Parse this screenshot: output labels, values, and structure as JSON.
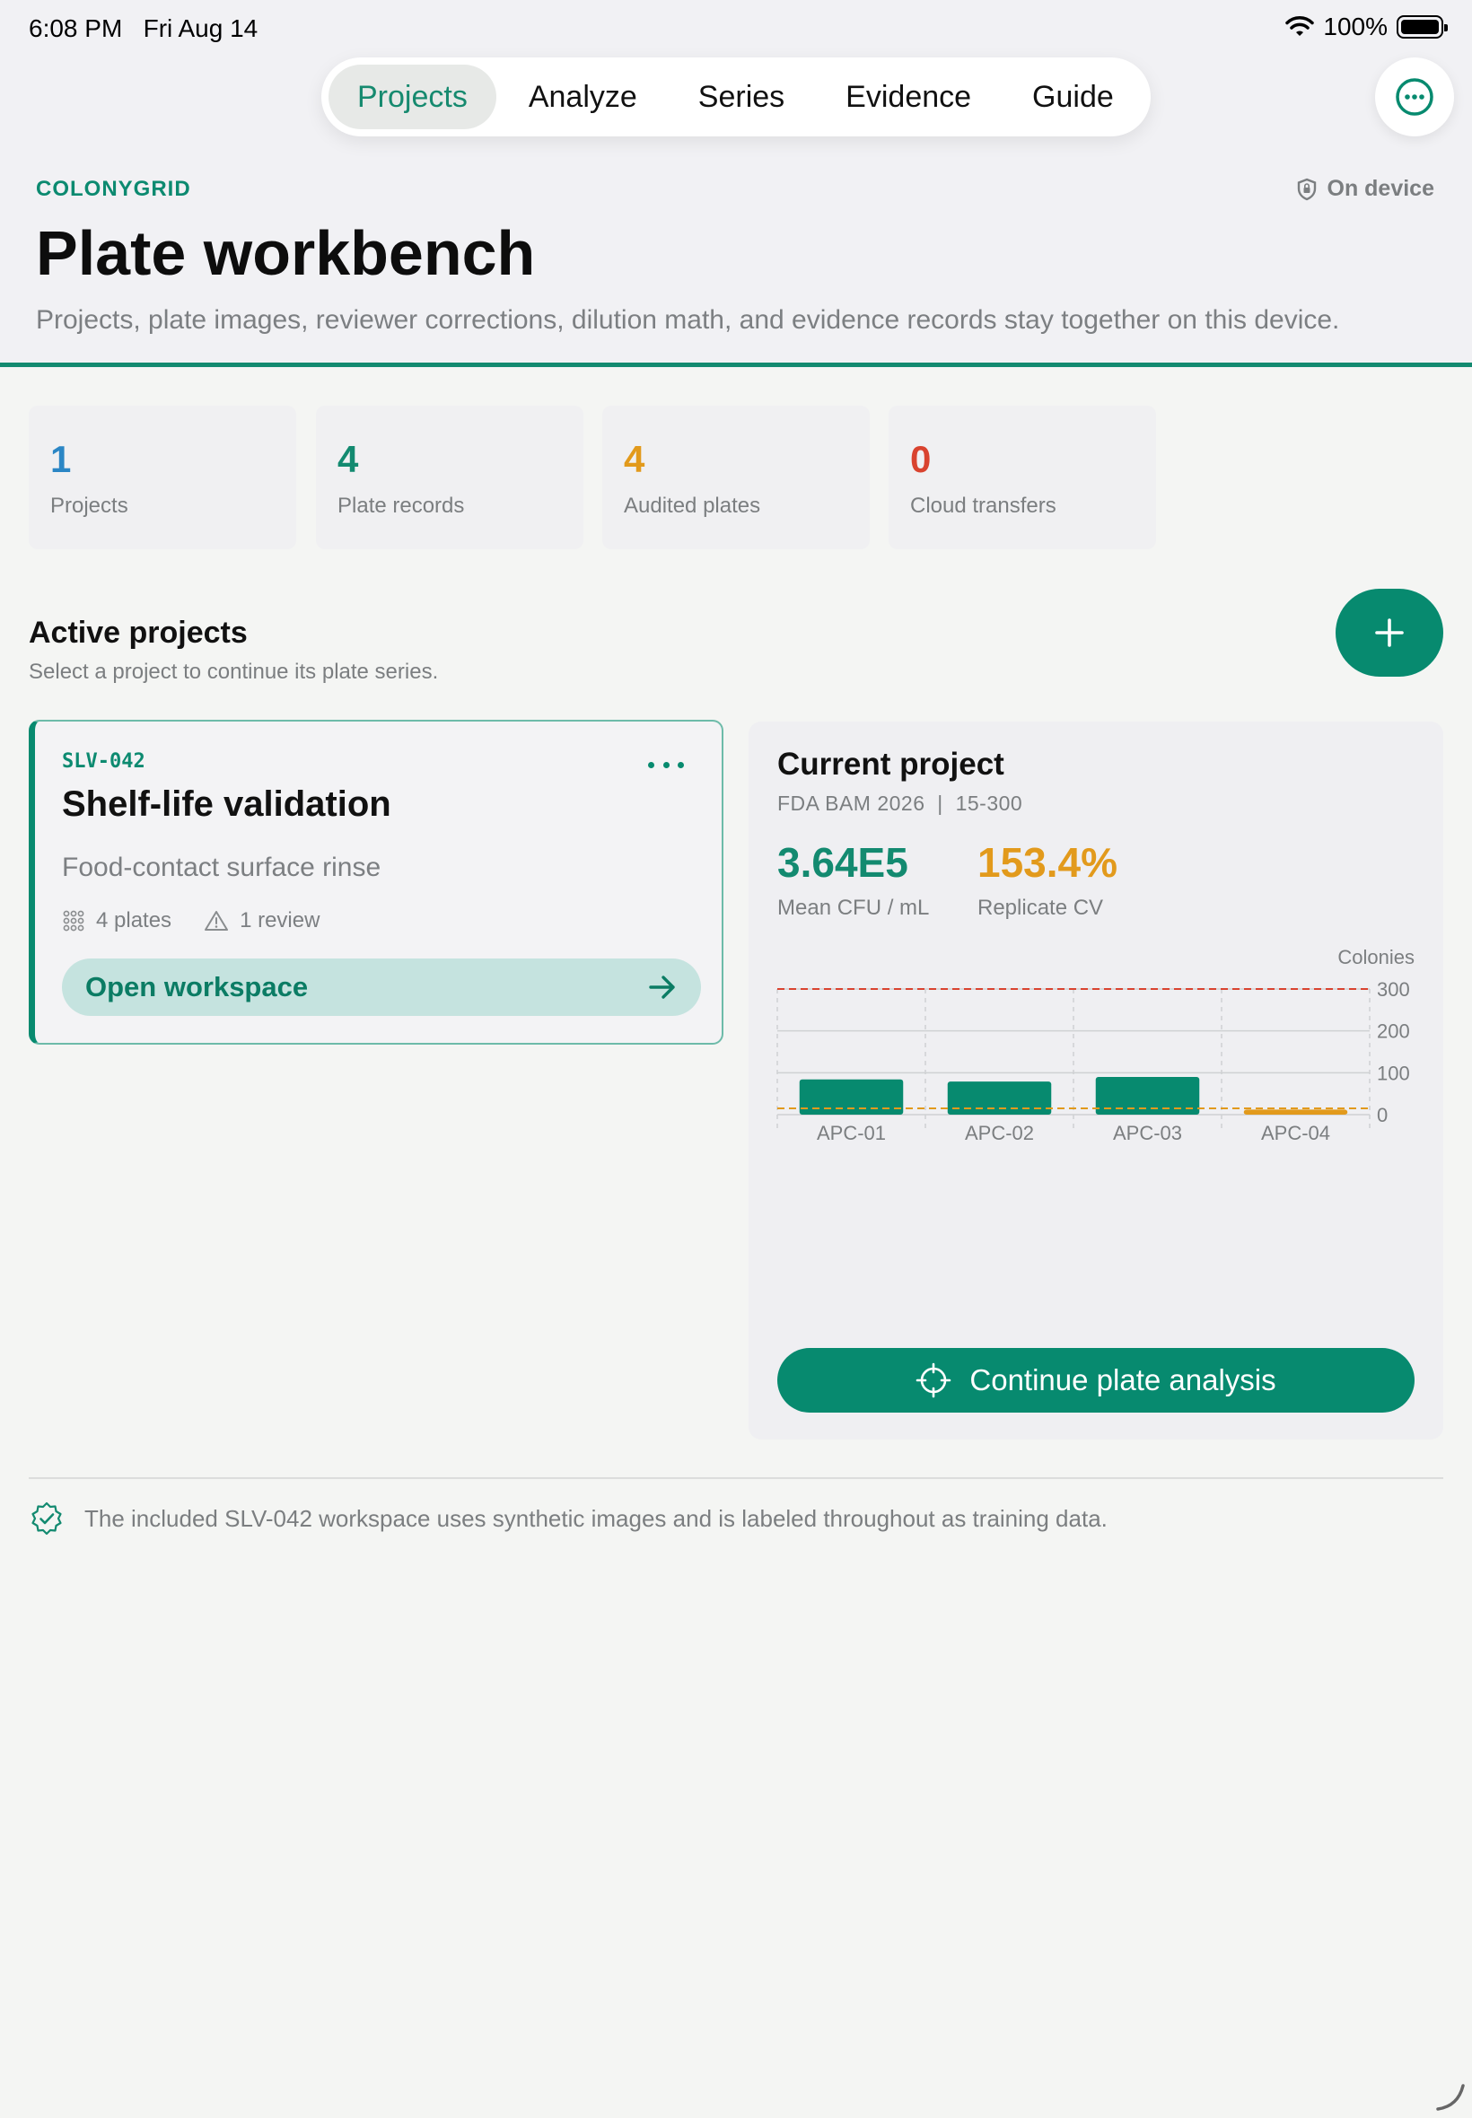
{
  "status_bar": {
    "time": "6:08 PM",
    "date": "Fri Aug 14",
    "battery": "100%",
    "icons": [
      "wifi-icon",
      "battery-icon"
    ]
  },
  "tabs": [
    {
      "label": "Projects",
      "active": true
    },
    {
      "label": "Analyze",
      "active": false
    },
    {
      "label": "Series",
      "active": false
    },
    {
      "label": "Evidence",
      "active": false
    },
    {
      "label": "Guide",
      "active": false
    }
  ],
  "header": {
    "brand": "COLONYGRID",
    "privacy": "On device",
    "title": "Plate workbench",
    "subtitle": "Projects, plate images, reviewer corrections, dilution math, and evidence records stay together on this device."
  },
  "stats": [
    {
      "value": "1",
      "label": "Projects",
      "color": "#2b86c5"
    },
    {
      "value": "4",
      "label": "Plate records",
      "color": "#138a70"
    },
    {
      "value": "4",
      "label": "Audited plates",
      "color": "#e29a1c"
    },
    {
      "value": "0",
      "label": "Cloud transfers",
      "color": "#d9432f"
    }
  ],
  "active_projects": {
    "title": "Active projects",
    "subtitle": "Select a project to continue its plate series."
  },
  "project_card": {
    "code": "SLV-042",
    "title": "Shelf-life validation",
    "description": "Food-contact surface rinse",
    "plates": "4 plates",
    "reviews": "1 review",
    "open_label": "Open workspace"
  },
  "current_project": {
    "title": "Current project",
    "method": "FDA BAM 2026",
    "range": "15-300",
    "mean_value": "3.64E5",
    "mean_label": "Mean CFU / mL",
    "cv_value": "153.4%",
    "cv_label": "Replicate CV",
    "continue_label": "Continue plate analysis"
  },
  "chart_data": {
    "type": "bar",
    "categories": [
      "APC-01",
      "APC-02",
      "APC-03",
      "APC-04"
    ],
    "values": [
      84,
      79,
      90,
      12
    ],
    "bar_colors": [
      "#078a6f",
      "#078a6f",
      "#078a6f",
      "#e29a1c"
    ],
    "ylabel": "Colonies",
    "ylim": [
      0,
      300
    ],
    "yticks": [
      0,
      100,
      200,
      300
    ],
    "upper_limit": 300,
    "lower_limit": 15,
    "upper_limit_color": "#d9432f",
    "lower_limit_color": "#e29a1c",
    "grid": true
  },
  "footnote": "The included SLV-042 workspace uses synthetic images and is labeled throughout as training data.",
  "colors": {
    "accent": "#078a6f",
    "accent_light": "#c5e3df",
    "warning": "#e29a1c",
    "danger": "#d9432f",
    "info": "#2b86c5"
  }
}
